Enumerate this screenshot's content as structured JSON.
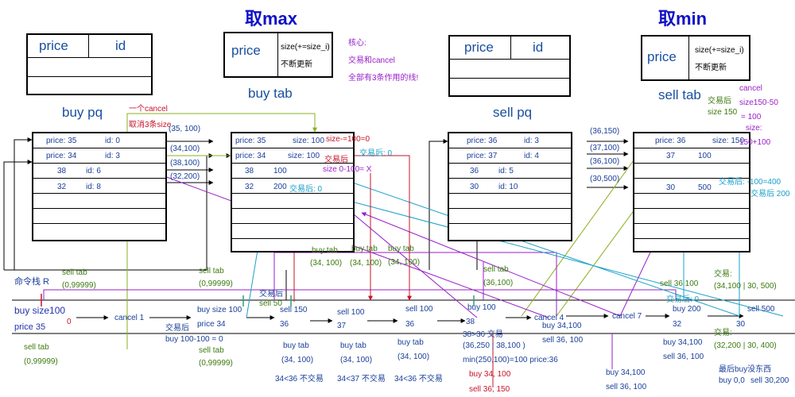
{
  "titles": {
    "max": "取max",
    "min": "取min"
  },
  "buy_pq": {
    "label": "buy pq",
    "header": {
      "price": "price",
      "id": "id"
    },
    "rows": [
      [
        "price: 35",
        "id: 0"
      ],
      [
        "price: 34",
        "id: 3"
      ],
      [
        "38",
        "id: 6"
      ],
      [
        "32",
        "id: 8"
      ]
    ]
  },
  "buy_tab": {
    "label": "buy tab",
    "header": {
      "price": "price",
      "size": "size(+=size_i)",
      "sub": "不断更新"
    },
    "rows": [
      [
        "price: 35",
        "size: 100"
      ],
      [
        "price: 34",
        "size: 100"
      ],
      [
        "38",
        "100"
      ],
      [
        "32",
        "200"
      ]
    ]
  },
  "sell_pq": {
    "label": "sell pq",
    "header": {
      "price": "price",
      "id": "id"
    },
    "rows": [
      [
        "price: 36",
        "id: 3"
      ],
      [
        "price: 37",
        "id: 4"
      ],
      [
        "36",
        "id: 5"
      ],
      [
        "30",
        "id: 10"
      ]
    ]
  },
  "sell_tab": {
    "label": "sell tab",
    "header": {
      "price": "price",
      "size": "size(+=size_i)",
      "sub": "不断更新"
    },
    "rows": [
      [
        "price: 36",
        "size: 150"
      ],
      [
        "37",
        "100"
      ],
      [
        "30",
        "500"
      ]
    ]
  },
  "core": [
    "核心:",
    "交易和cancel",
    "全部有3条作用的线!"
  ],
  "left_notes": {
    "cancel_one": "一个cancel",
    "cancel_3": "取消3条size",
    "arrows": [
      "(35, 100)",
      "(34,100)",
      "(38,100)",
      "(32,200)"
    ]
  },
  "buytab_notes": {
    "size_minus": "size-=100=0",
    "after_trade": "交易后",
    "after_zero": "交易后: 0",
    "size_0": "size 0-100= X",
    "after_zero2": "交易后: 0"
  },
  "sell_notes": {
    "arrows": [
      "(36,150)",
      "(37,100)",
      "(36,100)",
      "(30,500)"
    ],
    "after_trade": "交易后",
    "size150": "size 150",
    "cancel": "cancel",
    "size150_50": "size150-50",
    "eq100": "= 100",
    "size_colon": "size:",
    "s150p100": "150+100",
    "after_400": "交易后: -100=400",
    "after_200": "交易后 200"
  },
  "cmd_stack": "命令栈 R",
  "timeline": {
    "buy_size": "buy size100",
    "price35": "price 35",
    "zero": "0",
    "cancel1": "cancel 1",
    "buy_size_100": "buy size 100",
    "price34": "price 34",
    "sell150": "sell 150",
    "v36": "36",
    "sell100a": "sell 100",
    "v37": "37",
    "sell100b": "sell 100",
    "v36b": "36",
    "buy100": "buy 100",
    "v38": "38",
    "cancel4": "cancel 4",
    "cancel7": "cancel 7",
    "buy200": "buy 200",
    "v32": "32",
    "sell500": "sell 500",
    "v30": "30"
  },
  "above": {
    "sell_tab1": "sell tab",
    "z1": "(0,99999)",
    "sell_tab2": "sell tab",
    "z2": "(0,99999)",
    "trade_after": "交易后",
    "sell50": "sell 50",
    "buy_tab_a": "buy tab",
    "buy_tab_a_v": "(34, 100)",
    "buy_tab_b": "buy tab",
    "buy_tab_b_v": "(34, 100)",
    "buy_tab_c": "buy tab",
    "buy_tab_c_v": "(34, 100)",
    "sell_tab3": "sell tab",
    "sell_tab3_v": "(36,100)",
    "sell36": "sell 36 100",
    "after0": "交易后: 0",
    "trade_r1": "交易:",
    "trade_r1_v": "(34,100 | 30, 500)"
  },
  "below": {
    "sell_tab_l": "sell tab",
    "sell_tab_l_v": "(0,99999)",
    "after_trade": "交易后",
    "buy_calc": "buy 100-100 = 0",
    "sell_tab_m": "sell tab",
    "sell_tab_m_v": "(0,99999)",
    "bt1": "buy tab",
    "bt1_v": "(34, 100)",
    "bt1_n": "34<36 不交易",
    "bt2": "buy tab",
    "bt2_v": "(34, 100)",
    "bt2_n": "34<37 不交易",
    "bt3": "buy tab",
    "bt3_v": "(34, 100)",
    "bt3_n": "34<36 不交易",
    "trade38": "38>36 交易",
    "t38_v": "(36,250 | 38,100 )",
    "min": "min(250,100)=100  price:36",
    "buy34": "buy 34,   100",
    "sell36": "sell   36,   150",
    "c4_buy": "buy 34,100",
    "c4_sell": "sell 36, 100",
    "c7_buy": "buy 34,100",
    "c7_sell": "sell 36, 100",
    "b2_buy": "buy 34,100",
    "b2_sell": "sell 36, 100",
    "trade_r2": "交易:",
    "trade_r2_v": "(32,200 | 30, 400)",
    "last": "最后buy没东西",
    "last_buy": "buy 0,0",
    "last_sell": "sell 30,200"
  }
}
